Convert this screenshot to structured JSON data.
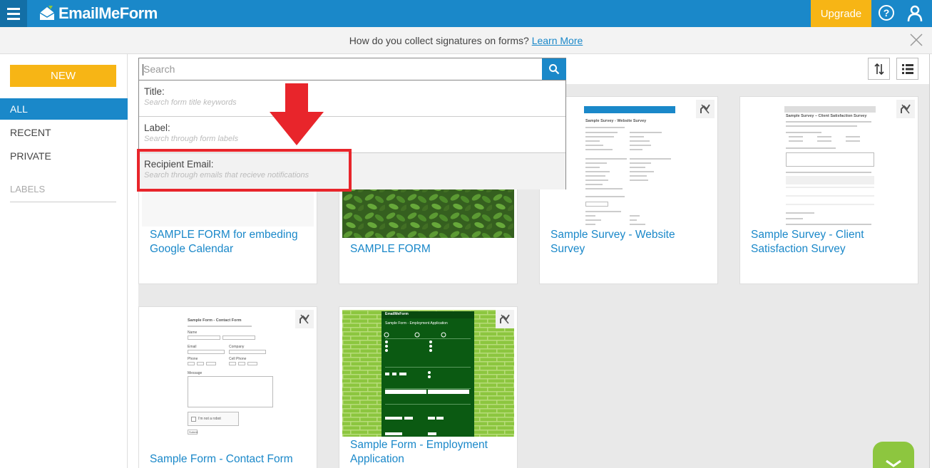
{
  "app": {
    "name": "EmailMeForm",
    "upgrade_label": "Upgrade",
    "help_glyph": "?",
    "accent_color": "#1a88c9",
    "upgrade_color": "#f7b515"
  },
  "notice": {
    "text": "How do you collect signatures on forms?",
    "link": "Learn More"
  },
  "sidebar": {
    "new_label": "NEW",
    "items": [
      {
        "label": "ALL",
        "active": true
      },
      {
        "label": "RECENT",
        "active": false
      },
      {
        "label": "PRIVATE",
        "active": false
      }
    ],
    "labels_heading": "LABELS"
  },
  "search": {
    "placeholder": "Search",
    "options": [
      {
        "label": "Title:",
        "hint": "Search form title keywords"
      },
      {
        "label": "Label:",
        "hint": "Search through form labels"
      },
      {
        "label": "Recipient Email:",
        "hint": "Search through emails that recieve notifications"
      }
    ]
  },
  "forms": [
    {
      "title": "SAMPLE FORM for embeding Google Calendar"
    },
    {
      "title": "SAMPLE FORM"
    },
    {
      "title": "Sample Survey - Website Survey"
    },
    {
      "title": "Sample Survey - Client Satisfaction Survey"
    },
    {
      "title": "Sample Form - Contact Form"
    },
    {
      "title": "Sample Form - Employment Application"
    }
  ],
  "thumbnails": {
    "website_survey_heading": "Sample Survey - Website Survey",
    "client_survey_heading": "Sample Survey – Client Satisfaction Survey",
    "contact_form_heading": "Sample Form - Contact Form",
    "contact_form_fields": [
      "Name",
      "Email",
      "Company",
      "Phone",
      "Cell Phone",
      "Message"
    ],
    "contact_captcha": "I'm not a robot",
    "contact_submit": "Submit",
    "employment_logo": "EmailMeForm",
    "employment_heading": "Sample Form - Employment Application"
  }
}
